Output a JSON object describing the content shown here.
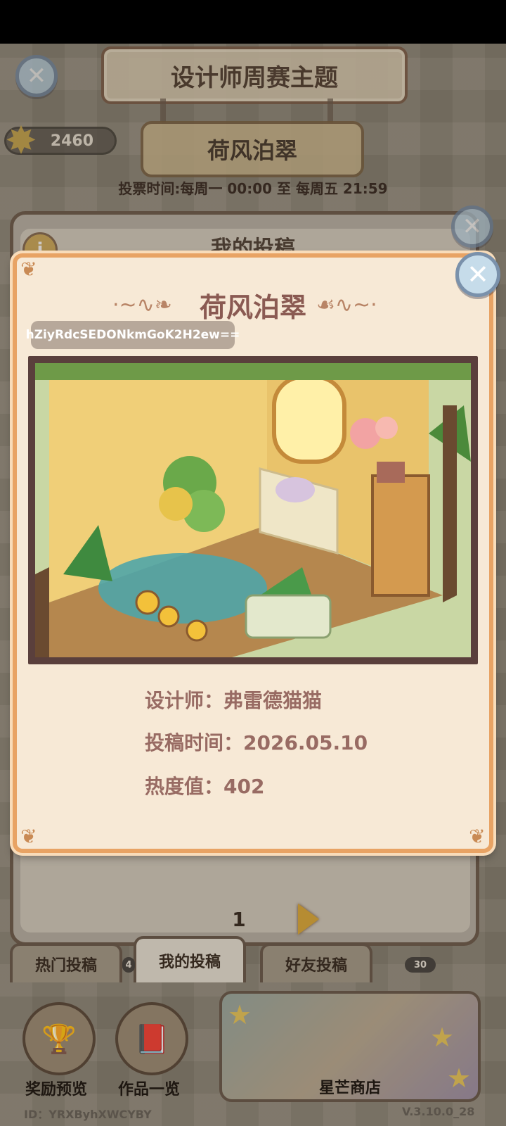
{
  "header": {
    "title": "设计师周赛主题",
    "theme_name": "荷风泊翠",
    "star_count": "2460",
    "vote_time": "投票时间:每周一 00:00 至 每周五 21:59"
  },
  "panel": {
    "title": "我的投稿",
    "page_number": "1",
    "tabs": [
      {
        "label": "热门投稿"
      },
      {
        "label": "我的投稿"
      },
      {
        "label": "好友投稿"
      }
    ],
    "badge_left": "4",
    "badge_right": "30"
  },
  "bottom": {
    "reward_label": "奖励预览",
    "works_label": "作品一览",
    "shop_label": "星芒商店",
    "id_text": "ID：YRXByhXWCYBY",
    "version_text": "V.3.10.0_28"
  },
  "modal": {
    "title": "荷风泊翠",
    "share_code": "hZiyRdcSEDONkmGoK2H2ew==",
    "designer_line": "设计师：弗雷德猫猫",
    "submit_time_line": "投稿时间：2026.05.10",
    "heat_line": "热度值：402"
  },
  "icons": {
    "close": "close-icon",
    "star": "star-icon",
    "info": "info-icon",
    "next": "next-page-arrow-icon"
  },
  "colors": {
    "modal_border": "#e8a364",
    "modal_bg": "#f7e9d6",
    "title_text": "#8a5a52",
    "close_button": "#c6dcea"
  }
}
